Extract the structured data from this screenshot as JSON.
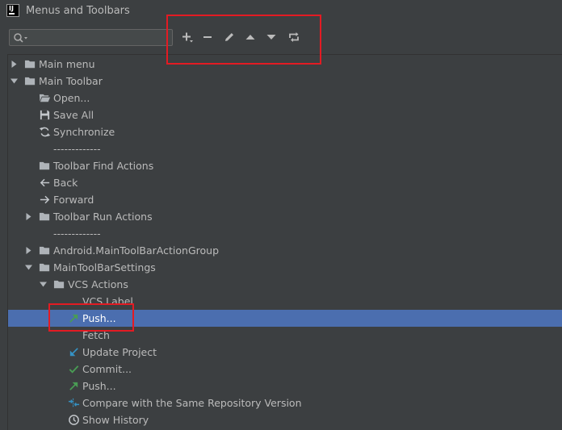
{
  "window": {
    "title": "Menus and Toolbars",
    "logo_text": "IJ"
  },
  "search": {
    "value": "",
    "placeholder": ""
  },
  "toolbar": {
    "buttons": [
      {
        "icon": "add-icon"
      },
      {
        "icon": "remove-icon"
      },
      {
        "icon": "edit-icon"
      },
      {
        "icon": "move-up-icon"
      },
      {
        "icon": "move-down-icon"
      },
      {
        "icon": "restore-icon"
      }
    ]
  },
  "colors": {
    "highlight": "#e31b23",
    "selection": "#4b6eaf",
    "folder": "#aeb3b8",
    "vcs_green": "#499c54",
    "vcs_blue": "#3592c4"
  },
  "tree": {
    "items": [
      {
        "label": "Main menu",
        "icon": "folder-icon",
        "arrow": "right"
      },
      {
        "label": "Main Toolbar",
        "icon": "folder-icon",
        "arrow": "down"
      },
      {
        "label": "Open...",
        "icon": "open-folder-icon"
      },
      {
        "label": "Save All",
        "icon": "save-icon"
      },
      {
        "label": "Synchronize",
        "icon": "sync-icon"
      },
      {
        "label": "-------------"
      },
      {
        "label": "Toolbar Find Actions",
        "icon": "folder-icon"
      },
      {
        "label": "Back",
        "icon": "arrow-left-icon"
      },
      {
        "label": "Forward",
        "icon": "arrow-right-icon"
      },
      {
        "label": "Toolbar Run Actions",
        "icon": "folder-icon",
        "arrow": "right"
      },
      {
        "label": "-------------"
      },
      {
        "label": "Android.MainToolBarActionGroup",
        "icon": "folder-icon",
        "arrow": "right"
      },
      {
        "label": "MainToolBarSettings",
        "icon": "folder-icon",
        "arrow": "down"
      },
      {
        "label": "VCS Actions",
        "icon": "folder-icon",
        "arrow": "down"
      },
      {
        "label": "VCS Label"
      },
      {
        "label": "Push...",
        "icon": "push-icon",
        "selected": true
      },
      {
        "label": "Fetch"
      },
      {
        "label": "Update Project",
        "icon": "update-icon"
      },
      {
        "label": "Commit...",
        "icon": "commit-icon"
      },
      {
        "label": "Push...",
        "icon": "push-icon"
      },
      {
        "label": "Compare with the Same Repository Version",
        "icon": "compare-icon"
      },
      {
        "label": "Show History",
        "icon": "history-icon"
      }
    ]
  }
}
